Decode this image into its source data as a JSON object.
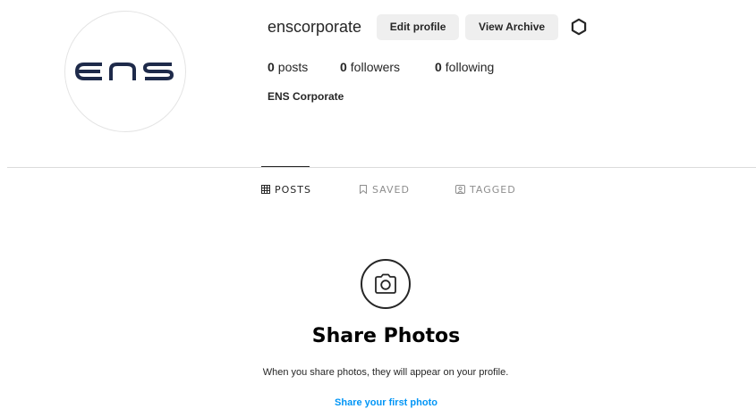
{
  "profile": {
    "username": "enscorporate",
    "full_name": "ENS Corporate",
    "avatar_icon": "ens-logo-icon",
    "avatar_color": "#1e2a4a",
    "edit_profile_label": "Edit profile",
    "view_archive_label": "View Archive",
    "settings_icon": "settings-icon"
  },
  "stats": {
    "posts_count": "0",
    "posts_label": "posts",
    "followers_count": "0",
    "followers_label": "followers",
    "following_count": "0",
    "following_label": "following"
  },
  "tabs": [
    {
      "label": "POSTS",
      "icon": "grid-icon",
      "active": true
    },
    {
      "label": "SAVED",
      "icon": "bookmark-icon",
      "active": false
    },
    {
      "label": "TAGGED",
      "icon": "tag-person-icon",
      "active": false
    }
  ],
  "empty_state": {
    "icon": "camera-icon",
    "title": "Share Photos",
    "subtitle": "When you share photos, they will appear on your profile.",
    "link_label": "Share your first photo",
    "link_color": "#0095f6"
  }
}
